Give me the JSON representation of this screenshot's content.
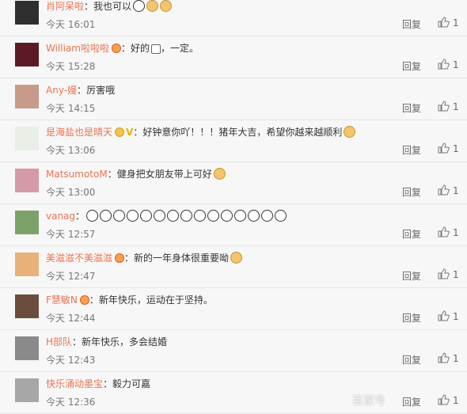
{
  "comments": [
    {
      "name": "肖阿呆啦",
      "badge": "none",
      "vip": "",
      "text": "我也可以",
      "emojis": [
        "panda",
        "face",
        "face"
      ],
      "time": "今天 16:01",
      "likes": "1",
      "reply": "回复",
      "avatar_color": "#2f2f2f"
    },
    {
      "name": "William啦啦啦",
      "badge": "orange",
      "vip": "",
      "text": "好的",
      "emojis": [
        "hand"
      ],
      "tail": "，一定。",
      "time": "今天 15:28",
      "likes": "1",
      "reply": "回复",
      "avatar_color": "#5a1b24"
    },
    {
      "name": "Any-嫚",
      "badge": "none",
      "vip": "",
      "text": "厉害哦",
      "emojis": [],
      "time": "今天 14:15",
      "likes": "1",
      "reply": "回复",
      "avatar_color": "#c89a8a"
    },
    {
      "name": "是海盐也是晴天",
      "badge": "gold",
      "vip": "V",
      "text": "好钟意你吖！！！猪年大吉，希望你越来越顺利",
      "emojis": [
        "face"
      ],
      "time": "今天 13:06",
      "likes": "1",
      "reply": "回复",
      "avatar_color": "#e9eee6"
    },
    {
      "name": "MatsumotoM",
      "badge": "none",
      "vip": "",
      "text": "健身把女朋友带上可好",
      "emojis": [
        "face"
      ],
      "time": "今天 13:00",
      "likes": "1",
      "reply": "回复",
      "avatar_color": "#d49aa6"
    },
    {
      "name": "vanag",
      "badge": "none",
      "vip": "",
      "text": "",
      "emojis": [
        "panda",
        "panda",
        "panda",
        "panda",
        "panda",
        "panda",
        "panda",
        "panda",
        "panda",
        "panda",
        "panda",
        "panda",
        "panda",
        "panda",
        "panda"
      ],
      "time": "今天 12:57",
      "likes": "1",
      "reply": "回复",
      "avatar_color": "#7da269"
    },
    {
      "name": "美滋滋不美滋滋",
      "badge": "orange",
      "vip": "",
      "text": "新的一年身体很重要呦",
      "emojis": [
        "face"
      ],
      "time": "今天 12:47",
      "likes": "1",
      "reply": "回复",
      "avatar_color": "#e6b27a"
    },
    {
      "name": "F慧敏N",
      "badge": "orange",
      "vip": "",
      "text": "新年快乐，运动在于坚持。",
      "emojis": [],
      "time": "今天 12:44",
      "likes": "1",
      "reply": "回复",
      "avatar_color": "#6c4d3d"
    },
    {
      "name": "H部队",
      "badge": "none",
      "vip": "",
      "text": "新年快乐，多会结婚",
      "emojis": [],
      "time": "今天 12:43",
      "likes": "1",
      "reply": "回复",
      "avatar_color": "#8a8a8a"
    },
    {
      "name": "快乐涌动墨宝",
      "badge": "none",
      "vip": "",
      "text": "毅力可嘉",
      "emojis": [],
      "time": "今天 12:36",
      "likes": "1",
      "reply": "回复",
      "avatar_color": "#a7a7a7"
    }
  ],
  "watermark": "百家号"
}
